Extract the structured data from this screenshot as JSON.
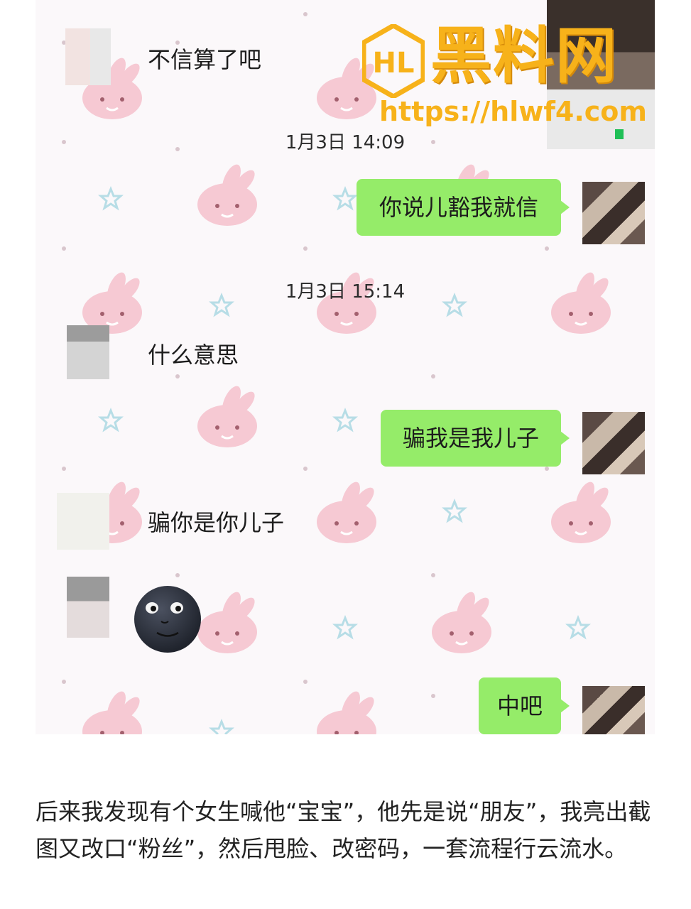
{
  "messages": [
    {
      "side": "them",
      "text": "不信算了吧"
    },
    {
      "side": "me",
      "text": "你说儿豁我就信"
    },
    {
      "side": "them",
      "text": "什么意思"
    },
    {
      "side": "me",
      "text": "骗我是我儿子"
    },
    {
      "side": "them",
      "text": "骗你是你儿子"
    },
    {
      "side": "them",
      "emoji": "new-moon-face"
    },
    {
      "side": "me",
      "text": "中吧"
    }
  ],
  "timestamps": [
    "1月3日 14:09",
    "1月3日 15:14"
  ],
  "watermark": {
    "title": "黑料网",
    "url": "https://hlwf4.com",
    "logo_text": "HL"
  },
  "caption": "后来我发现有个女生喊他“宝宝”，他先是说“朋友”，我亮出截图又改口“粉丝”，然后甩脸、改密码，一套流程行云流水。",
  "colors": {
    "my_bubble": "#95ec69",
    "watermark": "#f7b21a",
    "chat_bg": "#fbf8fa",
    "bunny": "#f6c9d3",
    "star": "#b7dde6"
  }
}
